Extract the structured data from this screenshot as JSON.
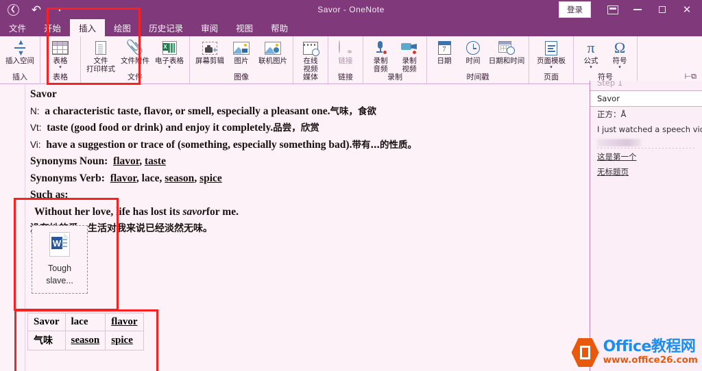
{
  "window": {
    "title": "Savor  -  OneNote",
    "signin_label": "登录",
    "back_icon": "back-circle-icon",
    "undo_icon": "undo-arrow-icon",
    "more_icon": "chevron-down-icon",
    "ribbon_display_icon": "ribbon-display-options-icon",
    "minimize_icon": "minimize-icon",
    "restore_icon": "restore-window-icon",
    "close_icon": "close-icon",
    "accent_color": "#80397b",
    "page_background": "#fdf2f7"
  },
  "tabs": [
    {
      "label": "文件",
      "active": false
    },
    {
      "label": "开始",
      "active": false
    },
    {
      "label": "插入",
      "active": true
    },
    {
      "label": "绘图",
      "active": false
    },
    {
      "label": "历史记录",
      "active": false
    },
    {
      "label": "审阅",
      "active": false
    },
    {
      "label": "视图",
      "active": false
    },
    {
      "label": "帮助",
      "active": false
    }
  ],
  "ribbon": {
    "pin_icon": "collapse-ribbon-icon",
    "groups": [
      {
        "label": "插入",
        "items": [
          {
            "label": "插入空间",
            "icon": "insert-space-icon",
            "caret": false,
            "disabled": false
          }
        ]
      },
      {
        "label": "表格",
        "items": [
          {
            "label": "表格",
            "icon": "table-icon",
            "caret": true,
            "disabled": false
          }
        ]
      },
      {
        "label": "文件",
        "items": [
          {
            "label": "文件\n打印样式",
            "icon": "file-printout-icon",
            "caret": false,
            "disabled": false
          },
          {
            "label": "文件附件",
            "icon": "paperclip-icon",
            "caret": false,
            "disabled": false
          },
          {
            "label": "电子表格",
            "icon": "spreadsheet-icon",
            "caret": true,
            "disabled": false
          }
        ]
      },
      {
        "label": "图像",
        "items": [
          {
            "label": "屏幕剪辑",
            "icon": "screen-clipping-icon",
            "caret": false,
            "disabled": false
          },
          {
            "label": "图片",
            "icon": "picture-icon",
            "caret": false,
            "disabled": false
          },
          {
            "label": "联机图片",
            "icon": "online-pictures-icon",
            "caret": false,
            "disabled": false
          }
        ]
      },
      {
        "label": "媒体",
        "items": [
          {
            "label": "在线\n视频",
            "icon": "online-video-icon",
            "caret": false,
            "disabled": false
          }
        ]
      },
      {
        "label": "链接",
        "items": [
          {
            "label": "链接",
            "icon": "link-icon",
            "caret": false,
            "disabled": true
          }
        ]
      },
      {
        "label": "录制",
        "items": [
          {
            "label": "录制\n音频",
            "icon": "record-audio-icon",
            "caret": false,
            "disabled": false
          },
          {
            "label": "录制\n视频",
            "icon": "record-video-icon",
            "caret": false,
            "disabled": false
          }
        ]
      },
      {
        "label": "时间戳",
        "items": [
          {
            "label": "日期",
            "icon": "calendar-date-icon",
            "caret": false,
            "disabled": false,
            "badge": "7"
          },
          {
            "label": "时间",
            "icon": "clock-icon",
            "caret": false,
            "disabled": false
          },
          {
            "label": "日期和时间",
            "icon": "date-time-icon",
            "caret": false,
            "disabled": false
          }
        ]
      },
      {
        "label": "页面",
        "items": [
          {
            "label": "页面模板",
            "icon": "page-template-icon",
            "caret": true,
            "disabled": false
          }
        ]
      },
      {
        "label": "符号",
        "items": [
          {
            "label": "公式",
            "icon": "equation-pi-icon",
            "caret": true,
            "disabled": false,
            "glyph": "π"
          },
          {
            "label": "符号",
            "icon": "symbol-omega-icon",
            "caret": true,
            "disabled": false,
            "glyph": "Ω"
          }
        ]
      }
    ]
  },
  "document": {
    "title": "Savor",
    "lines": [
      {
        "id": "line-title",
        "segments": [
          {
            "text": "Savor",
            "style": "bold"
          }
        ]
      },
      {
        "id": "line-noun",
        "segments": [
          {
            "text": "N:",
            "style": "pos"
          },
          {
            "text": "a characteristic taste, flavor, or smell, especially a pleasant one.",
            "style": "bold"
          },
          {
            "text": "气味，食欲",
            "style": "cn"
          }
        ]
      },
      {
        "id": "line-vt",
        "segments": [
          {
            "text": "Vt:",
            "style": "pos"
          },
          {
            "text": "taste (good food or drink) and enjoy it completely.",
            "style": "bold"
          },
          {
            "text": "品尝，欣赏",
            "style": "cn"
          }
        ]
      },
      {
        "id": "line-vi",
        "segments": [
          {
            "text": "Vi:",
            "style": "pos"
          },
          {
            "text": "have a suggestion or trace of (something, especially something bad).",
            "style": "bold"
          },
          {
            "text": "带有…的性质。",
            "style": "cn"
          }
        ]
      },
      {
        "id": "line-syn-noun",
        "segments": [
          {
            "text": "Synonyms Noun:",
            "style": "bold"
          },
          {
            "text": "flavor",
            "style": "underline"
          },
          {
            "text": ", ",
            "style": "bold"
          },
          {
            "text": "taste",
            "style": "underline"
          }
        ]
      },
      {
        "id": "line-syn-verb",
        "segments": [
          {
            "text": "Synonyms Verb:",
            "style": "bold"
          },
          {
            "text": "flavor",
            "style": "underline"
          },
          {
            "text": ", lace, ",
            "style": "bold"
          },
          {
            "text": "season",
            "style": "underline"
          },
          {
            "text": ", ",
            "style": "bold"
          },
          {
            "text": "spice",
            "style": "underline"
          }
        ]
      },
      {
        "id": "line-such-as",
        "segments": [
          {
            "text": "Such as:",
            "style": "bold"
          }
        ]
      },
      {
        "id": "line-example",
        "segments": [
          {
            "text": "Without her love, life has lost its ",
            "style": "bold"
          },
          {
            "text": "savor",
            "style": "italic"
          },
          {
            "text": "for me.",
            "style": "bold"
          }
        ]
      },
      {
        "id": "line-example-cn",
        "segments": [
          {
            "text": "没有她的爱，生活对我来说已经淡然无味。",
            "style": "cn-line"
          }
        ]
      }
    ],
    "attachment": {
      "icon": "word-document-icon",
      "badge_letter": "W",
      "filename_line1": "Tough",
      "filename_line2": "slave..."
    },
    "table": {
      "rows": [
        [
          {
            "text": "Savor",
            "underline": false,
            "cn": false
          },
          {
            "text": "lace",
            "underline": false,
            "cn": false
          },
          {
            "text": "flavor",
            "underline": true,
            "cn": false
          }
        ],
        [
          {
            "text": "气味",
            "underline": false,
            "cn": true
          },
          {
            "text": "season",
            "underline": true,
            "cn": false
          },
          {
            "text": "spice",
            "underline": true,
            "cn": false
          }
        ]
      ]
    }
  },
  "right_panel": {
    "rows": [
      {
        "text": "Step 1",
        "state": "clipped"
      },
      {
        "text": "Savor",
        "state": "selected"
      },
      {
        "text": "正方：Å",
        "state": "normal"
      },
      {
        "text": "I just watched a speech videoTh",
        "state": "normal"
      },
      {
        "text": "",
        "state": "blurred"
      },
      {
        "text": "这是第一个",
        "state": "underlined"
      },
      {
        "text": "无标题页",
        "state": "underlined"
      }
    ]
  },
  "annotations": {
    "boxes": [
      {
        "name": "insert-tab-highlight",
        "color": "#fc1f1f"
      },
      {
        "name": "file-attachment-highlight",
        "color": "#fc1f1f"
      },
      {
        "name": "table-highlight",
        "color": "#fc1f1f"
      }
    ]
  },
  "watermark": {
    "title": "Office教程网",
    "url": "www.office26.com",
    "logo_icon": "office-hexagon-logo-icon",
    "title_color": "#1b8ff0",
    "url_color": "#e8590c"
  }
}
